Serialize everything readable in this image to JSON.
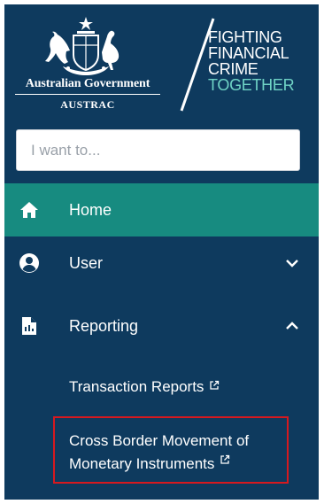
{
  "header": {
    "government_name": "Australian Government",
    "agency": "AUSTRAC",
    "tagline": [
      "FIGHTING",
      "FINANCIAL",
      "CRIME",
      "TOGETHER"
    ],
    "crest_icon": "coat-of-arms-icon"
  },
  "search": {
    "placeholder": "I want to...",
    "value": ""
  },
  "nav": {
    "home": {
      "label": "Home",
      "icon": "home-icon",
      "active": true
    },
    "user": {
      "label": "User",
      "icon": "user-circle-icon",
      "expand_icon": "chevron-down-icon"
    },
    "reporting": {
      "label": "Reporting",
      "icon": "report-file-icon",
      "expand_icon": "chevron-up-icon"
    },
    "subitems": [
      {
        "label": "Transaction Reports",
        "icon": "external-link-icon"
      },
      {
        "label": "Cross Border Movement of Monetary Instruments",
        "icon": "external-link-icon",
        "highlighted": true
      }
    ]
  },
  "colors": {
    "background": "#0e3a5e",
    "active": "#178b80",
    "tagline_accent": "#6fd3c5",
    "highlight_border": "#d6191f"
  }
}
